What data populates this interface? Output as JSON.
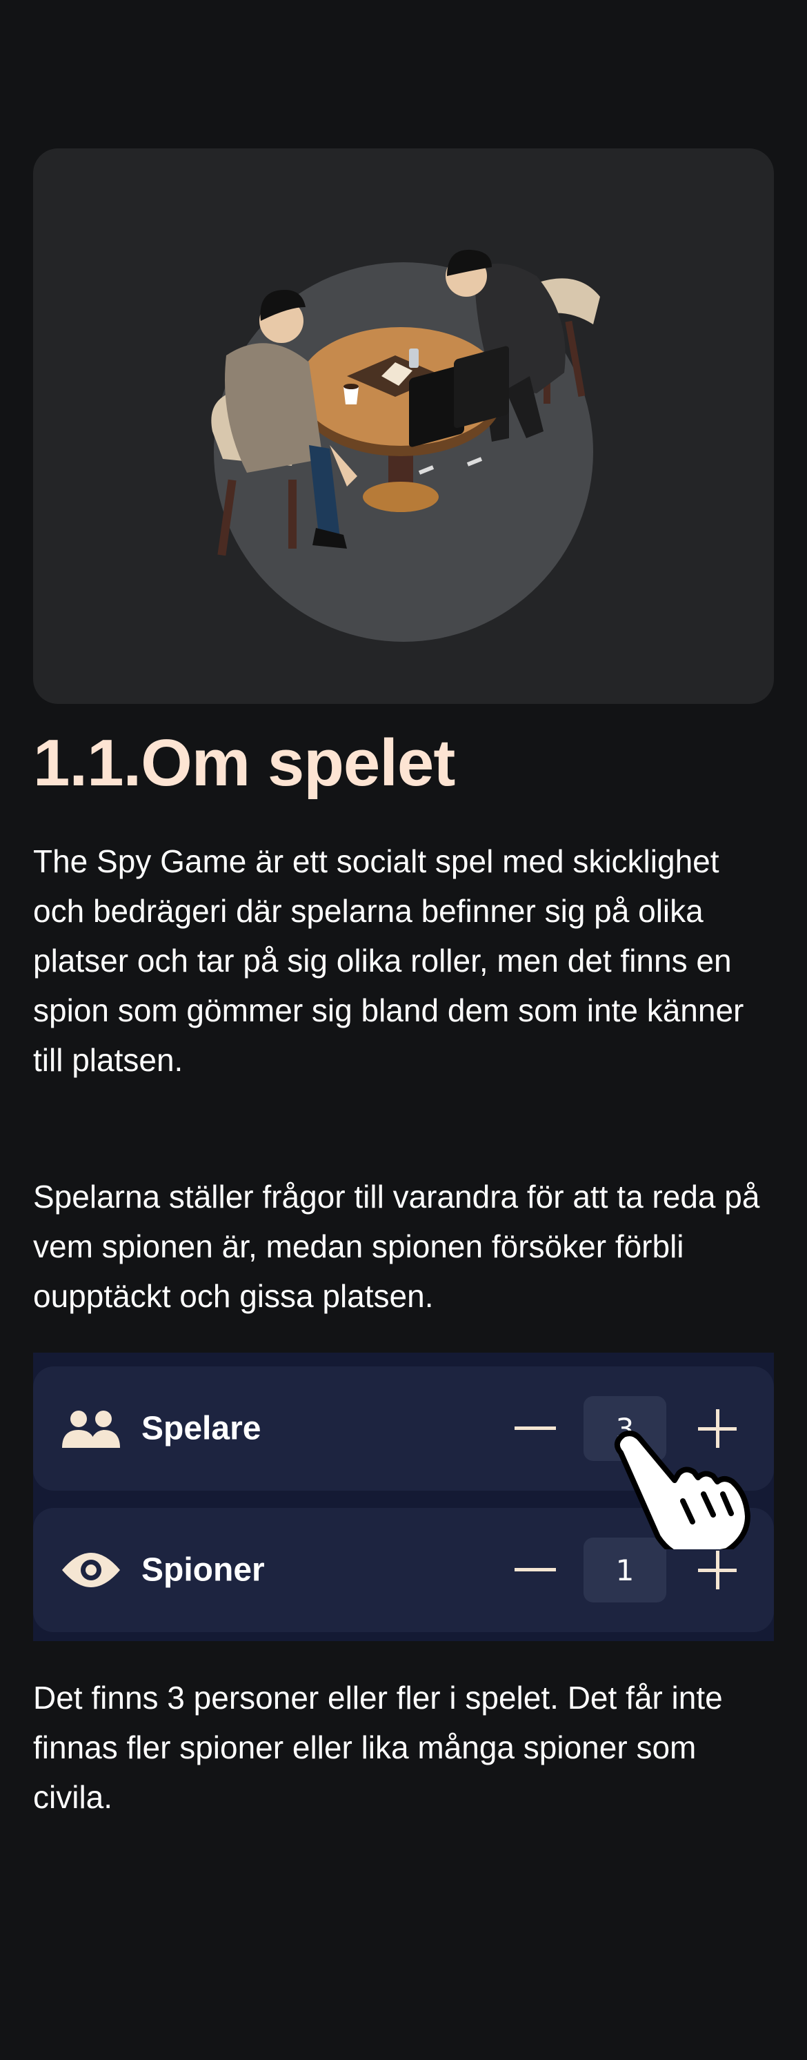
{
  "title": "1.1.Om spelet",
  "paragraphs": {
    "intro": "The Spy Game är ett socialt spel med skicklighet och bedrägeri där spelarna befinner sig på olika platser och tar på sig olika roller, men det finns en spion som gömmer sig bland dem som inte känner till platsen.",
    "questions": "Spelarna ställer frågor till varandra för att ta reda på vem spionen är, medan spionen försöker förbli oupptäckt och gissa platsen.",
    "rules": "Det finns 3 personer eller fler i spelet. Det får inte finnas fler spioner eller lika många spioner som civila."
  },
  "counters": {
    "players": {
      "label": "Spelare",
      "value": "3",
      "icon": "people-icon"
    },
    "spies": {
      "label": "Spioner",
      "value": "1",
      "icon": "eye-icon"
    }
  },
  "colors": {
    "background": "#121315",
    "card": "#242527",
    "title": "#fde4d3",
    "panel": "#141a34",
    "row": "#1d2440",
    "icon": "#f5e6d3"
  }
}
